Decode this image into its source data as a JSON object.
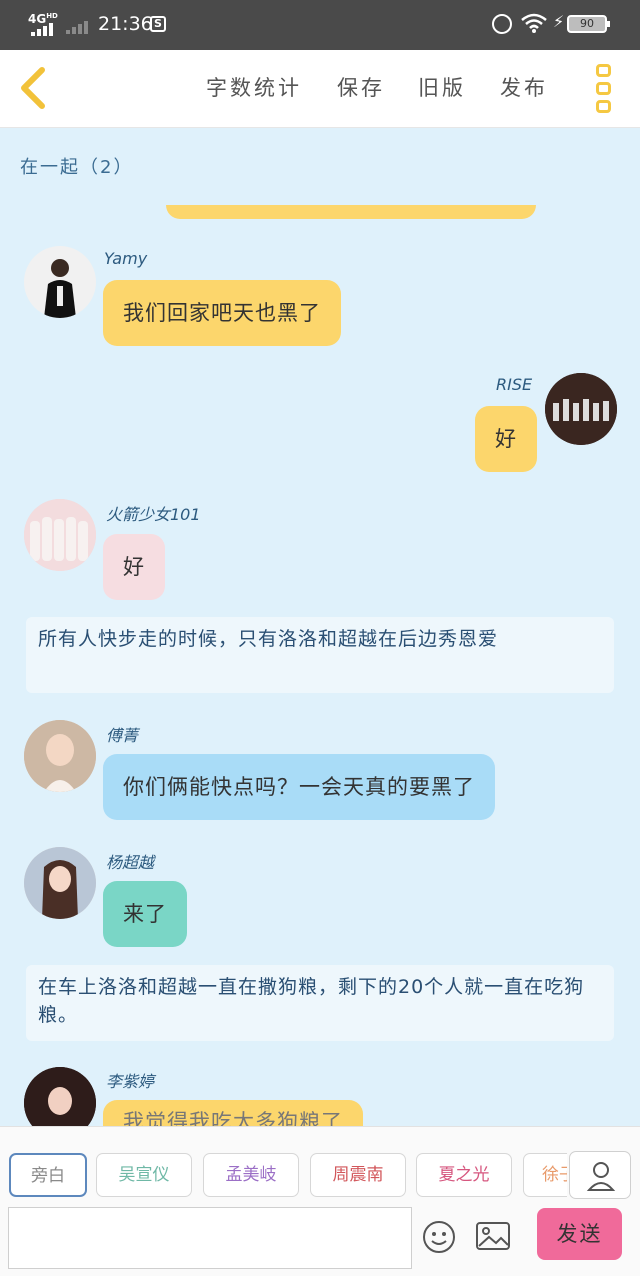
{
  "status_bar": {
    "network": "4G",
    "network_sub": "HD",
    "time": "21:36",
    "s_icon": "S",
    "battery": "90"
  },
  "toolbar": {
    "word_count": "字数统计",
    "save": "保存",
    "old_version": "旧版",
    "publish": "发布"
  },
  "chat": {
    "title": "在一起（2）",
    "messages": [
      {
        "sender": "Yamy",
        "text": "我们回家吧天也黑了",
        "side": "left",
        "color": "#fcd66c"
      },
      {
        "sender": "RISE",
        "text": "好",
        "side": "right",
        "color": "#fcd66c"
      },
      {
        "sender": "火箭少女101",
        "text": "好",
        "side": "left",
        "color": "#f6dde1"
      },
      {
        "narration": "所有人快步走的时候，只有洛洛和超越在后边秀恩爱"
      },
      {
        "sender": "傅菁",
        "text": "你们俩能快点吗？一会天真的要黑了",
        "side": "left",
        "color": "#a9dcf7"
      },
      {
        "sender": "杨超越",
        "text": "来了",
        "side": "left",
        "color": "#7ad6c6"
      },
      {
        "narration": "在车上洛洛和超越一直在撒狗粮，剩下的20个人就一直在吃狗粮。"
      },
      {
        "sender": "李紫婷",
        "text": "我觉得我吃太多狗粮了",
        "side": "left",
        "color": "#fcd66c"
      }
    ]
  },
  "roles": [
    {
      "label": "旁白",
      "color": "#8a8a8a"
    },
    {
      "label": "吴宣仪",
      "color": "#6fb8a6"
    },
    {
      "label": "孟美岐",
      "color": "#9b6fc6"
    },
    {
      "label": "周震南",
      "color": "#d2575b"
    },
    {
      "label": "夏之光",
      "color": "#d6577f"
    },
    {
      "label": "徐子",
      "color": "#e89a6a"
    }
  ],
  "composer": {
    "input_value": "",
    "send": "发送"
  },
  "icons": {
    "back": "chevron-left-icon",
    "more": "more-vertical-icon",
    "role": "person-icon",
    "emoji": "smile-icon",
    "image": "image-icon",
    "alarm": "alarm-icon",
    "wifi": "wifi-icon",
    "charging": "bolt-icon"
  }
}
